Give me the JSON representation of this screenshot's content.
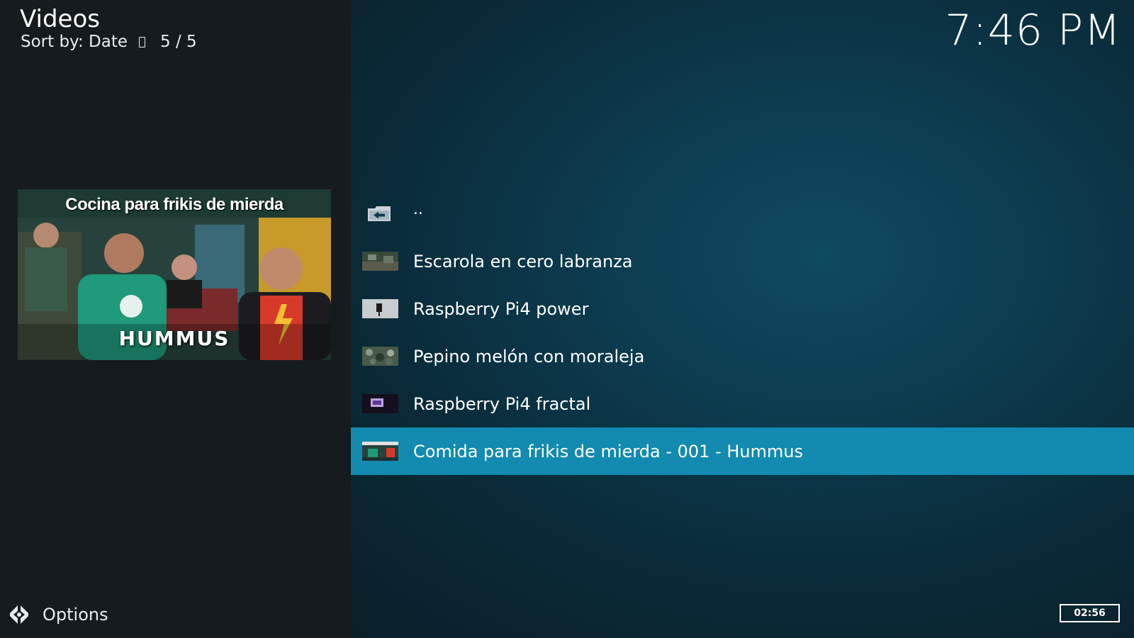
{
  "header": {
    "title": "Videos",
    "sort_label": "Sort by: Date",
    "count": "5 / 5"
  },
  "clock": "7:46 PM",
  "preview": {
    "title_text": "Cocina para frikis de mierda",
    "caption": "HUMMUS"
  },
  "list": {
    "items": [
      {
        "label": "..",
        "icon": "folder-back-icon"
      },
      {
        "label": "Escarola en cero labranza",
        "thumb": "thumbnail"
      },
      {
        "label": "Raspberry Pi4 power",
        "thumb": "thumbnail"
      },
      {
        "label": "Pepino melón con moraleja",
        "thumb": "thumbnail"
      },
      {
        "label": "Raspberry Pi4 fractal",
        "thumb": "thumbnail"
      },
      {
        "label": "Comida para frikis de mierda - 001 - Hummus",
        "thumb": "thumbnail",
        "selected": true
      }
    ]
  },
  "footer": {
    "options_label": "Options",
    "duration": "02:56"
  },
  "colors": {
    "accent": "#138aaf",
    "sidebar_bg": "#151b1e",
    "main_bg": "#0c3a4d"
  }
}
